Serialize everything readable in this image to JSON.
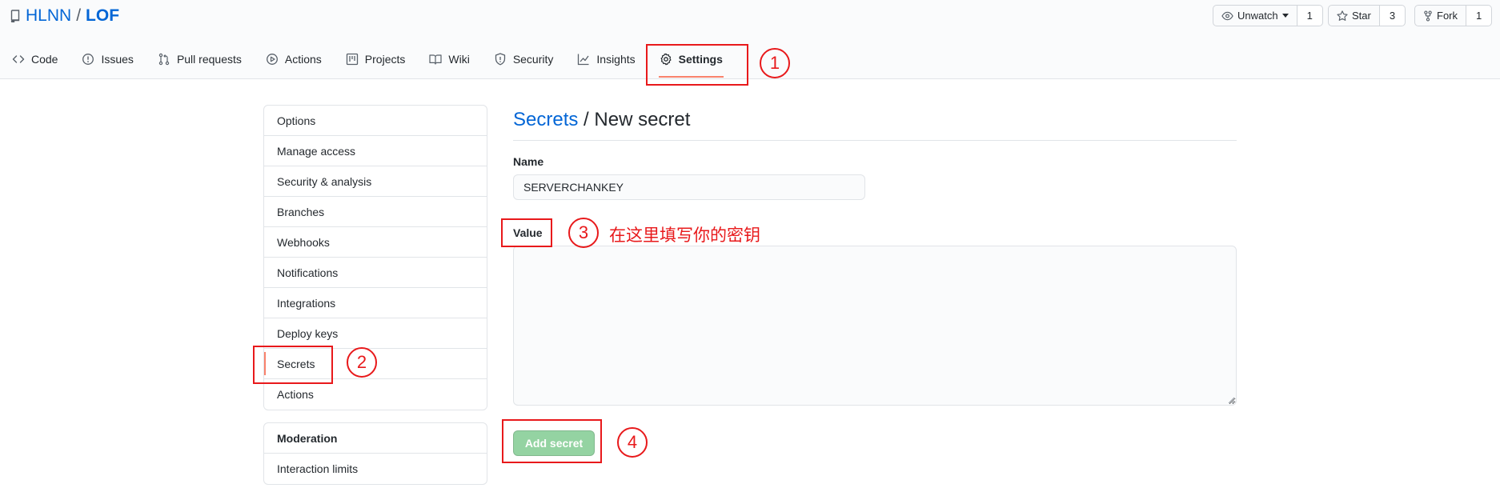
{
  "repo": {
    "owner": "HLNN",
    "separator": "/",
    "name": "LOF"
  },
  "actions": {
    "watch": {
      "label": "Unwatch",
      "count": "1"
    },
    "star": {
      "label": "Star",
      "count": "3"
    },
    "fork": {
      "label": "Fork",
      "count": "1"
    }
  },
  "tabs": [
    {
      "label": "Code",
      "icon": "code-icon"
    },
    {
      "label": "Issues",
      "icon": "issue-icon"
    },
    {
      "label": "Pull requests",
      "icon": "pull-request-icon"
    },
    {
      "label": "Actions",
      "icon": "play-icon"
    },
    {
      "label": "Projects",
      "icon": "project-icon"
    },
    {
      "label": "Wiki",
      "icon": "book-icon"
    },
    {
      "label": "Security",
      "icon": "shield-icon"
    },
    {
      "label": "Insights",
      "icon": "graph-icon"
    },
    {
      "label": "Settings",
      "icon": "gear-icon",
      "selected": true
    }
  ],
  "sidebar": {
    "items": [
      "Options",
      "Manage access",
      "Security & analysis",
      "Branches",
      "Webhooks",
      "Notifications",
      "Integrations",
      "Deploy keys",
      "Secrets",
      "Actions"
    ],
    "selected": "Secrets",
    "moderation": {
      "heading": "Moderation",
      "items": [
        "Interaction limits"
      ]
    }
  },
  "main": {
    "breadcrumb_link": "Secrets",
    "breadcrumb_sep": "/",
    "title": "New secret",
    "name_label": "Name",
    "name_value": "SERVERCHANKEY",
    "value_label": "Value",
    "value_text": "",
    "submit_label": "Add secret"
  },
  "annotations": {
    "step1": "1",
    "step2": "2",
    "step3": "3",
    "step4": "4",
    "note": "在这里填写你的密钥"
  },
  "colors": {
    "link": "#0366d6",
    "tab_underline": "#f9826c",
    "annotation": "#e8191b",
    "button_disabled": "#94d3a2"
  }
}
